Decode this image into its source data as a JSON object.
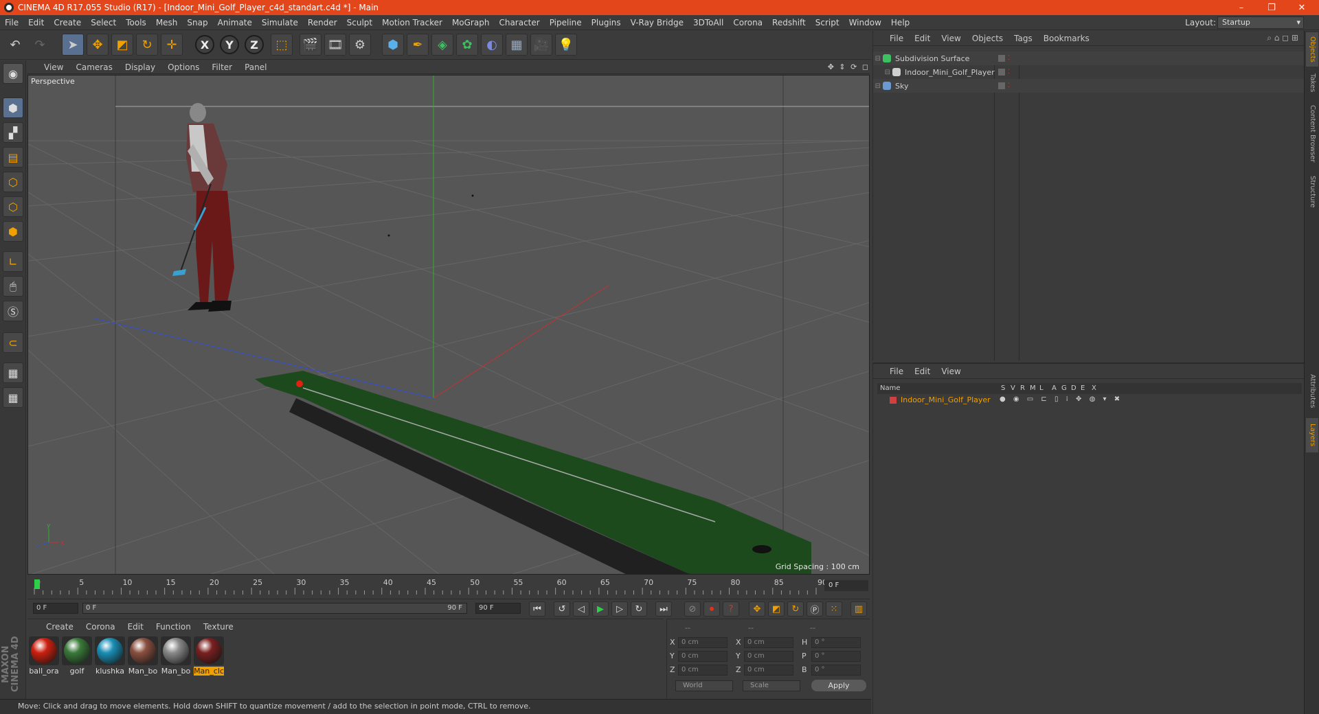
{
  "titlebar": {
    "title": "CINEMA 4D R17.055 Studio (R17) - [Indoor_Mini_Golf_Player_c4d_standart.c4d *] - Main",
    "controls": [
      "–",
      "❐",
      "✕"
    ]
  },
  "menubar": {
    "items": [
      "File",
      "Edit",
      "Create",
      "Select",
      "Tools",
      "Mesh",
      "Snap",
      "Animate",
      "Simulate",
      "Render",
      "Sculpt",
      "Motion Tracker",
      "MoGraph",
      "Character",
      "Pipeline",
      "Plugins",
      "V-Ray Bridge",
      "3DToAll",
      "Corona",
      "Redshift",
      "Script",
      "Window",
      "Help"
    ],
    "layout_label": "Layout:",
    "layout_value": "Startup"
  },
  "toolbar": {
    "undo_icon": "undo-icon",
    "redo_icon": "redo-icon",
    "axis_labels": [
      "X",
      "Y",
      "Z"
    ]
  },
  "viewport": {
    "menu": [
      "View",
      "Cameras",
      "Display",
      "Options",
      "Filter",
      "Panel"
    ],
    "label": "Perspective",
    "grid_spacing": "Grid Spacing : 100 cm",
    "colors": {
      "background": "#555555",
      "grid": "#6a6a6a",
      "green_axis": "#2fb02f",
      "red_axis": "#c83030",
      "blue_axis": "#3050d0"
    }
  },
  "timeline": {
    "ticks": [
      "0",
      "5",
      "10",
      "15",
      "20",
      "25",
      "30",
      "35",
      "40",
      "45",
      "50",
      "55",
      "60",
      "65",
      "70",
      "75",
      "80",
      "85",
      "90"
    ],
    "current_frame": "0 F"
  },
  "transport": {
    "start_field": "0 F",
    "range_start": "0 F",
    "range_end": "90 F",
    "end_field": "90 F"
  },
  "materials": {
    "menu": [
      "Create",
      "Corona",
      "Edit",
      "Function",
      "Texture"
    ],
    "items": [
      {
        "label": "ball_ora",
        "color": "#cc2010",
        "selected": false
      },
      {
        "label": "golf",
        "color": "#3a7a3a",
        "selected": false
      },
      {
        "label": "klushka",
        "color": "#1a8fb5",
        "selected": false
      },
      {
        "label": "Man_bo",
        "color": "#8a5040",
        "selected": false
      },
      {
        "label": "Man_bo",
        "color": "#8a8a8a",
        "selected": false
      },
      {
        "label": "Man_clc",
        "color": "#7a2020",
        "selected": true
      }
    ]
  },
  "coordinates": {
    "headers": [
      "--",
      "--",
      "--"
    ],
    "rows": [
      {
        "a": "X",
        "av": "0 cm",
        "b": "X",
        "bv": "0 cm",
        "c": "H",
        "cv": "0 °"
      },
      {
        "a": "Y",
        "av": "0 cm",
        "b": "Y",
        "bv": "0 cm",
        "c": "P",
        "cv": "0 °"
      },
      {
        "a": "Z",
        "av": "0 cm",
        "b": "Z",
        "bv": "0 cm",
        "c": "B",
        "cv": "0 °"
      }
    ],
    "world": "World",
    "scale": "Scale",
    "apply": "Apply"
  },
  "statusbar": {
    "text": "Move: Click and drag to move elements. Hold down SHIFT to quantize movement / add to the selection in point mode, CTRL to remove."
  },
  "logo": {
    "text": "MAXON CINEMA 4D"
  },
  "objects_panel": {
    "menu": [
      "File",
      "Edit",
      "View",
      "Objects",
      "Tags",
      "Bookmarks"
    ],
    "items": [
      {
        "name": "Subdivision Surface",
        "icon_color": "#3cc060",
        "indent": 0
      },
      {
        "name": "Indoor_Mini_Golf_Player",
        "icon_color": "#d0d0d0",
        "indent": 1
      },
      {
        "name": "Sky",
        "icon_color": "#6a9ad0",
        "indent": 0
      }
    ]
  },
  "layers_panel": {
    "menu": [
      "File",
      "Edit",
      "View"
    ],
    "columns": [
      "Name",
      "S",
      "V",
      "R",
      "M",
      "L",
      "A",
      "G",
      "D",
      "E",
      "X"
    ],
    "row_name": "Indoor_Mini_Golf_Player",
    "row_color": "#d04040"
  },
  "right_tabs": [
    "Objects",
    "Takes",
    "Content Browser",
    "Structure",
    "Attributes",
    "Layers"
  ]
}
